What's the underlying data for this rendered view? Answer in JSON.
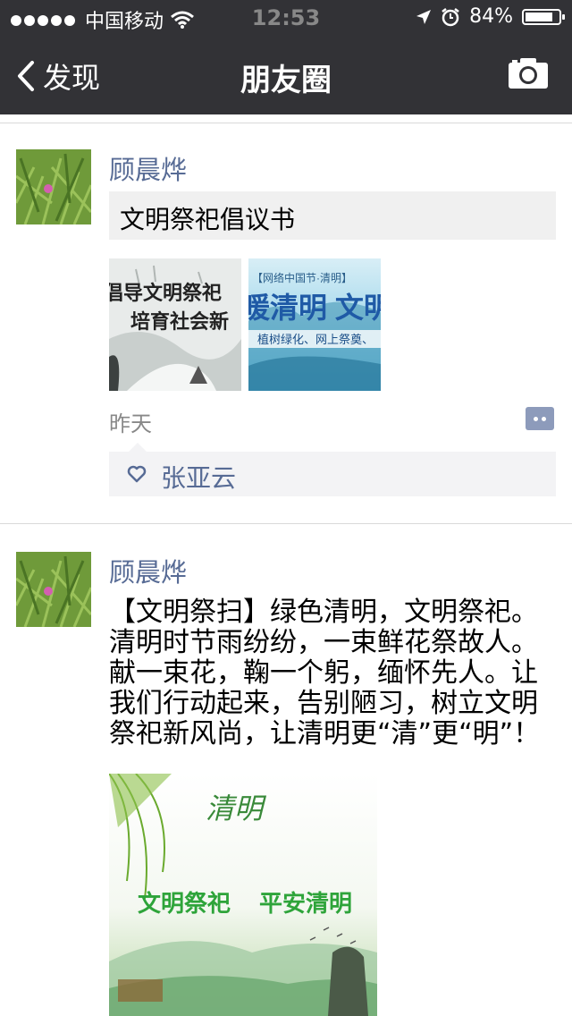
{
  "status_bar": {
    "carrier": "中国移动",
    "time": "12:53",
    "battery": "84%",
    "battery_level": 0.84
  },
  "nav": {
    "back_label": "发现",
    "title": "朋友圈",
    "camera_icon": "camera-icon"
  },
  "posts": [
    {
      "author": "顾晨烨",
      "share_title": "文明祭祀倡议书",
      "images": [
        {
          "lines": [
            "倡导文明祭祀",
            "培育社会新"
          ]
        },
        {
          "banner": "【网络中国节·清明】",
          "headline": "暖清明 文明祭",
          "subline": "植树绿化、网上祭奠、"
        }
      ],
      "time": "昨天",
      "likes": [
        "张亚云"
      ]
    },
    {
      "author": "顾晨烨",
      "text": "【文明祭扫】绿色清明，文明祭祀。清明时节雨纷纷，一束鲜花祭故人。献一束花，鞠一个躬，缅怀先人。让我们行动起来，告别陋习，树立文明祭祀新风尚，让清明更“清”更“明”！",
      "poster": {
        "script": "清明",
        "left": "文明祭祀",
        "right": "平安清明"
      }
    }
  ],
  "colors": {
    "topbar": "#323236",
    "name": "#576b95",
    "likes_bg": "#f3f3f5",
    "card_bg": "#f0f0f0"
  }
}
